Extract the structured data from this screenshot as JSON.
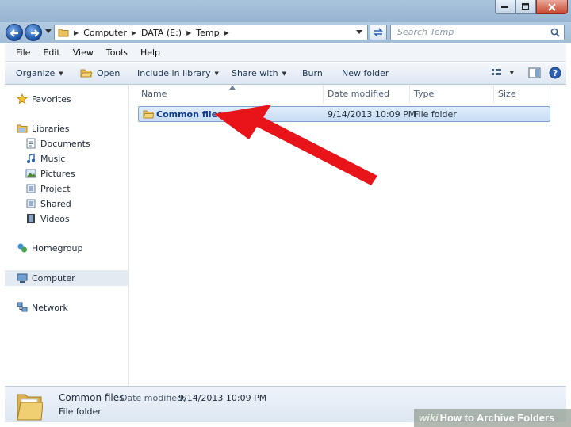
{
  "address": {
    "crumbs": [
      "Computer",
      "DATA (E:)",
      "Temp"
    ],
    "search_placeholder": "Search Temp"
  },
  "menu": [
    "File",
    "Edit",
    "View",
    "Tools",
    "Help"
  ],
  "commands": {
    "organize": "Organize",
    "open": "Open",
    "include": "Include in library",
    "share": "Share with",
    "burn": "Burn",
    "new_folder": "New folder"
  },
  "nav": {
    "favorites": "Favorites",
    "libraries": "Libraries",
    "library_items": [
      "Documents",
      "Music",
      "Pictures",
      "Project",
      "Shared",
      "Videos"
    ],
    "homegroup": "Homegroup",
    "computer": "Computer",
    "network": "Network"
  },
  "columns": [
    "Name",
    "Date modified",
    "Type",
    "Size"
  ],
  "files": [
    {
      "name": "Common files",
      "date": "9/14/2013 10:09 PM",
      "type": "File folder",
      "size": ""
    }
  ],
  "details": {
    "name": "Common files",
    "date_label": "Date modified:",
    "date_value": "9/14/2013 10:09 PM",
    "type": "File folder"
  },
  "watermark": {
    "prefix": "wiki",
    "text": "How to Archive Folders"
  },
  "colors": {
    "annotation_arrow": "#e8141a",
    "selection": "#c7dcf3"
  }
}
